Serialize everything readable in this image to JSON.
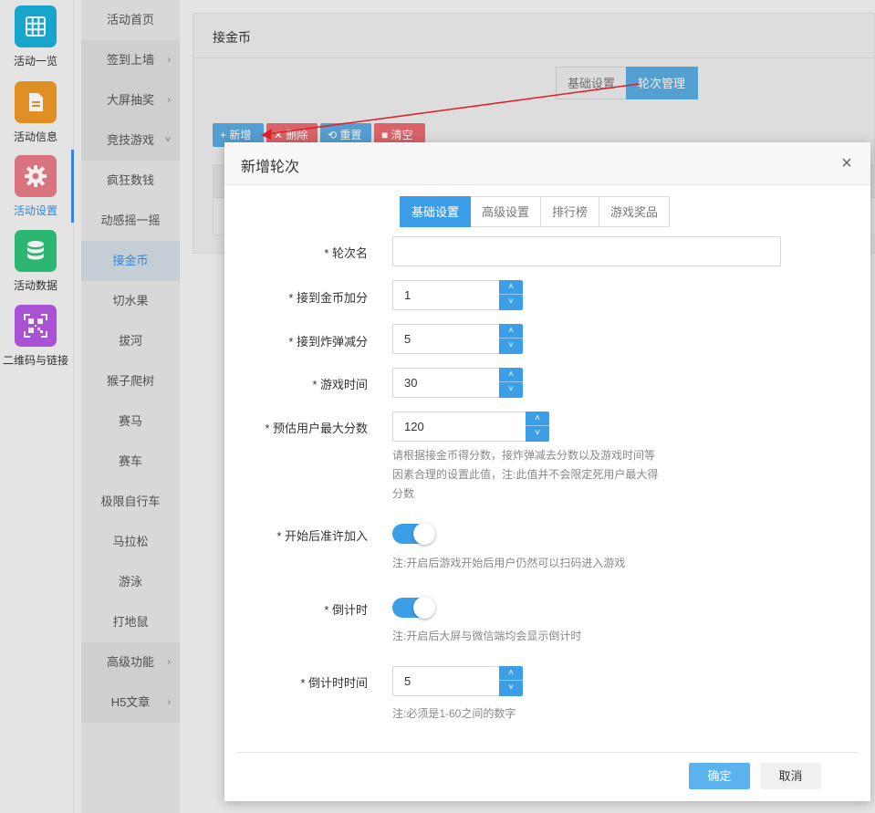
{
  "sidebar": {
    "items": [
      {
        "label": "活动一览",
        "icon": "grid-icon",
        "color": "#1ab0d8"
      },
      {
        "label": "活动信息",
        "icon": "document-icon",
        "color": "#ef9a26"
      },
      {
        "label": "活动设置",
        "icon": "gear-icon",
        "color": "#e77b88"
      },
      {
        "label": "活动数据",
        "icon": "database-icon",
        "color": "#2ec27a"
      },
      {
        "label": "二维码与链接",
        "icon": "qrcode-icon",
        "color": "#b458e2"
      }
    ]
  },
  "submenu": {
    "items": [
      {
        "label": "活动首页"
      },
      {
        "label": "签到上墙",
        "chevron": "›"
      },
      {
        "label": "大屏抽奖",
        "chevron": "›"
      },
      {
        "label": "竞技游戏",
        "chevron": "˅"
      },
      {
        "label": "疯狂数钱"
      },
      {
        "label": "动感摇一摇"
      },
      {
        "label": "接金币"
      },
      {
        "label": "切水果"
      },
      {
        "label": "拔河"
      },
      {
        "label": "猴子爬树"
      },
      {
        "label": "赛马"
      },
      {
        "label": "赛车"
      },
      {
        "label": "极限自行车"
      },
      {
        "label": "马拉松"
      },
      {
        "label": "游泳"
      },
      {
        "label": "打地鼠"
      },
      {
        "label": "高级功能",
        "chevron": "›"
      },
      {
        "label": "H5文章",
        "chevron": "›"
      }
    ]
  },
  "main": {
    "title": "接金币",
    "tabs": [
      "基础设置",
      "轮次管理"
    ],
    "toolbar": {
      "add": "+ 新增",
      "delete": "✕ 删除",
      "reset": "⟲ 重置",
      "clear": "■ 清空"
    }
  },
  "dialog": {
    "title": "新增轮次",
    "close": "×",
    "tabs": [
      "基础设置",
      "高级设置",
      "排行榜",
      "游戏奖品"
    ],
    "fields": {
      "round_name": {
        "label": "* 轮次名",
        "value": ""
      },
      "coin_score": {
        "label": "* 接到金币加分",
        "value": "1"
      },
      "bomb_score": {
        "label": "* 接到炸弹减分",
        "value": "5"
      },
      "game_time": {
        "label": "* 游戏时间",
        "value": "30"
      },
      "max_score": {
        "label": "* 预估用户最大分数",
        "value": "120",
        "hint_lines": [
          "请根据接金币得分数，接炸弹减去分数以及游戏时间等",
          "因素合理的设置此值，注:此值并不会限定死用户最大得",
          "分数"
        ]
      },
      "allow_join": {
        "label": "* 开始后准许加入",
        "hint": "注:开启后游戏开始后用户仍然可以扫码进入游戏"
      },
      "countdown": {
        "label": "* 倒计时",
        "hint": "注:开启后大屏与微信端均会显示倒计时"
      },
      "countdown_time": {
        "label": "* 倒计时时间",
        "value": "5",
        "hint": "注:必须是1-60之间的数字"
      }
    },
    "stepper": {
      "up": "˄",
      "down": "˅"
    },
    "ok": "确定",
    "cancel": "取消"
  },
  "colors": {
    "accent": "#3d9ee8",
    "danger": "#e76a6f",
    "annotation_arrow": "#e0202a"
  }
}
